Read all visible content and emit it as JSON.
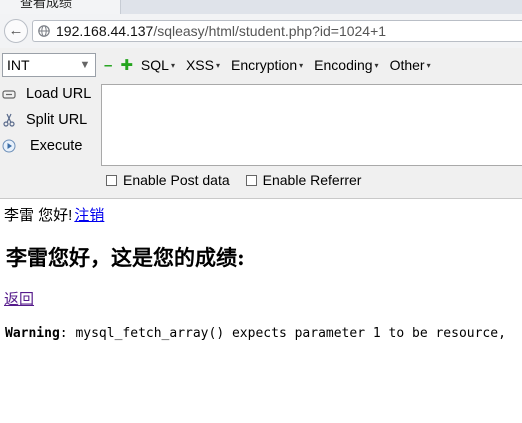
{
  "browser": {
    "tab_title": "查看成绩",
    "url_host": "192.168.44.137",
    "url_path": "/sqleasy/html/student.php?id=1024+1"
  },
  "hackbar": {
    "type_select": "INT",
    "menus": [
      "SQL",
      "XSS",
      "Encryption",
      "Encoding",
      "Other"
    ],
    "actions": {
      "load": "Load URL",
      "split": "Split URL",
      "execute": "Execute"
    },
    "post_data": "",
    "checkboxes": {
      "post": "Enable Post data",
      "referrer": "Enable Referrer"
    }
  },
  "page": {
    "greeting": "李雷 您好!",
    "logout": "注销",
    "heading": "李雷您好，这是您的成绩:",
    "back": "返回",
    "warning_label": "Warning",
    "warning_text": ": mysql_fetch_array() expects parameter 1 to be resource,"
  },
  "colors": {
    "link": "#0000ee",
    "visited_link": "#551a8b",
    "accent_green": "#25a51f"
  }
}
